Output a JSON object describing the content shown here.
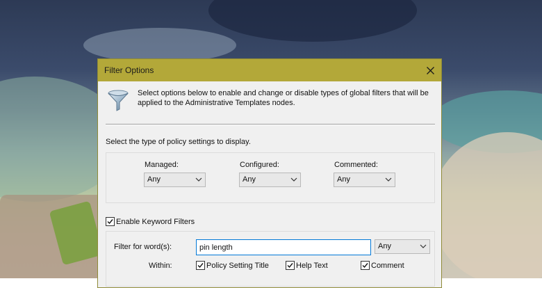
{
  "dialog": {
    "title": "Filter Options",
    "intro": "Select options below to enable and change or disable types of global filters that will be applied to the Administrative Templates nodes.",
    "type_prompt": "Select the type of policy settings to display.",
    "columns": [
      {
        "label": "Managed:",
        "value": "Any"
      },
      {
        "label": "Configured:",
        "value": "Any"
      },
      {
        "label": "Commented:",
        "value": "Any"
      }
    ],
    "keyword": {
      "enable_label": "Enable Keyword Filters",
      "enabled": true,
      "filter_label": "Filter for word(s):",
      "filter_value": "pin length",
      "match_value": "Any",
      "within_label": "Within:",
      "options": [
        {
          "label": "Policy Setting Title",
          "checked": true
        },
        {
          "label": "Help Text",
          "checked": true
        },
        {
          "label": "Comment",
          "checked": true
        }
      ]
    }
  },
  "icons": {
    "close": "close-icon",
    "filter": "funnel-icon",
    "dropdown": "chevron-down-icon",
    "check": "checkmark-icon"
  },
  "colors": {
    "titlebar": "#b3a839",
    "dialog_bg": "#f0f0f0",
    "input_focus": "#0078d7"
  }
}
